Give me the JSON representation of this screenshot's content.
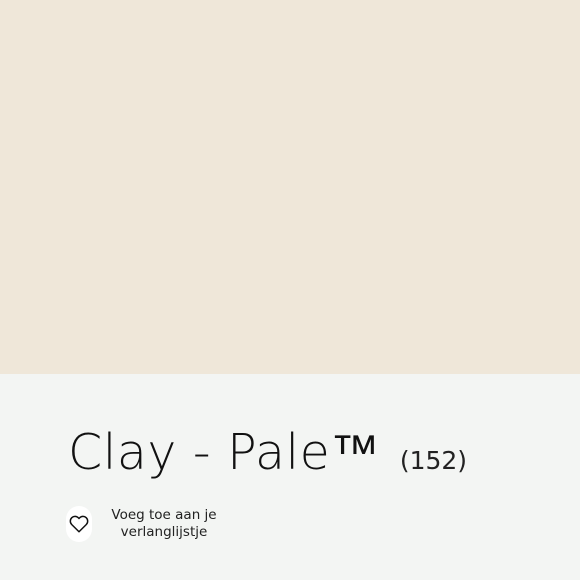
{
  "swatch": {
    "color": "#efe7d9"
  },
  "product": {
    "name": "Clay - Pale™",
    "code": "(152)"
  },
  "wishlist": {
    "icon": "heart-icon",
    "label_line1": "Voeg toe aan je",
    "label_line2": "verlanglijstje"
  }
}
